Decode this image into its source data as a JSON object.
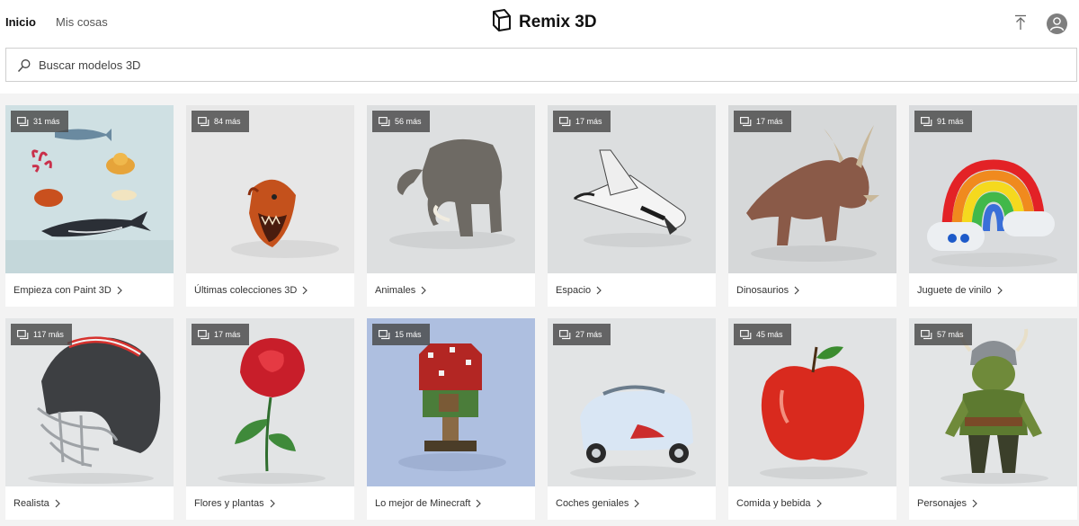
{
  "nav": {
    "home": "Inicio",
    "my_stuff": "Mis cosas"
  },
  "brand": {
    "title": "Remix 3D"
  },
  "search": {
    "placeholder": "Buscar modelos 3D"
  },
  "collections": [
    {
      "count": "31 más",
      "title": "Empieza con Paint 3D",
      "icon": "fish-collection"
    },
    {
      "count": "84 más",
      "title": "Últimas colecciones 3D",
      "icon": "anglerfish"
    },
    {
      "count": "56 más",
      "title": "Animales",
      "icon": "elephant"
    },
    {
      "count": "17 más",
      "title": "Espacio",
      "icon": "space-shuttle"
    },
    {
      "count": "17 más",
      "title": "Dinosaurios",
      "icon": "triceratops"
    },
    {
      "count": "91 más",
      "title": "Juguete de vinilo",
      "icon": "rainbow-toy"
    },
    {
      "count": "117 más",
      "title": "Realista",
      "icon": "football-helmet"
    },
    {
      "count": "17 más",
      "title": "Flores y plantas",
      "icon": "rose"
    },
    {
      "count": "15 más",
      "title": "Lo mejor de Minecraft",
      "icon": "minecraft-mushroom-house"
    },
    {
      "count": "27 más",
      "title": "Coches geniales",
      "icon": "toy-car"
    },
    {
      "count": "45 más",
      "title": "Comida y bebida",
      "icon": "apple"
    },
    {
      "count": "57 más",
      "title": "Personajes",
      "icon": "orc-character"
    }
  ]
}
